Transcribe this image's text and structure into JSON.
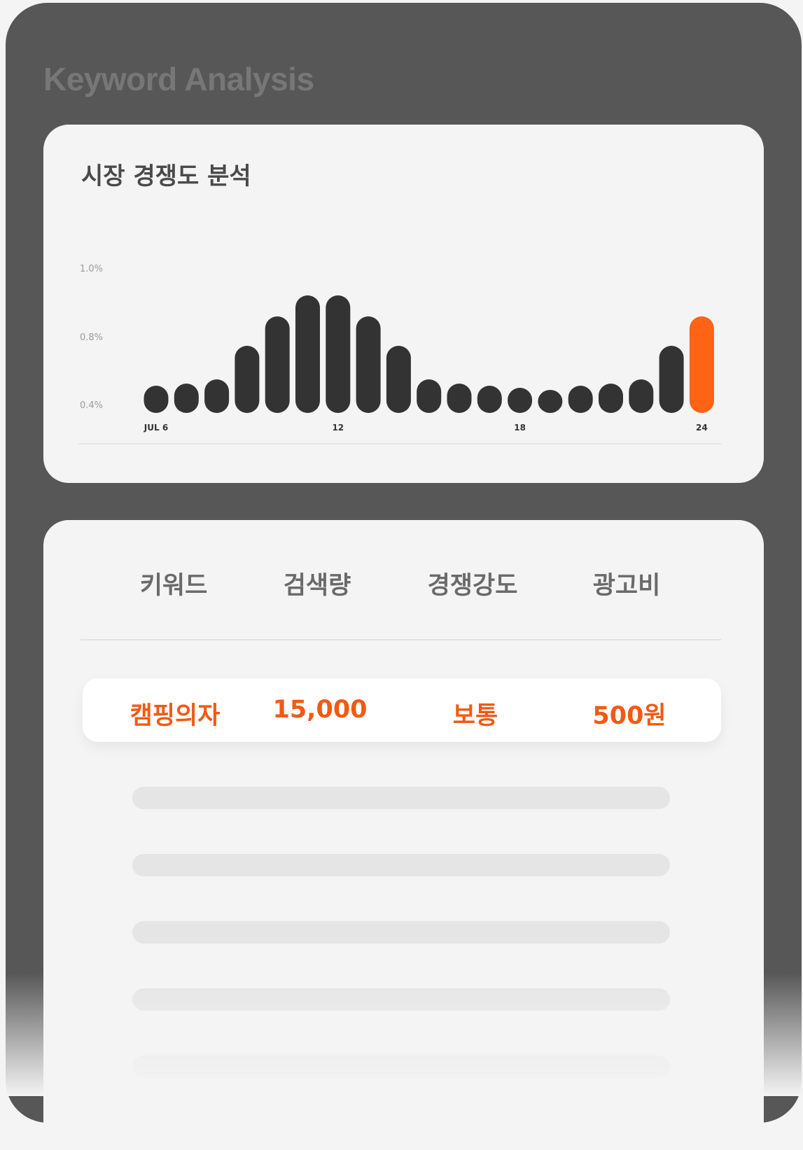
{
  "app": {
    "title": "Keyword Analysis"
  },
  "chart_card": {
    "title": "시장 경쟁도 분석"
  },
  "chart_data": {
    "type": "bar",
    "title": "시장 경쟁도 분석",
    "x": [
      6,
      7,
      8,
      9,
      10,
      11,
      12,
      13,
      14,
      15,
      16,
      17,
      18,
      19,
      20,
      21,
      22,
      23,
      24
    ],
    "x_tick_labels": [
      {
        "x": 6,
        "label": "JUL 6"
      },
      {
        "x": 12,
        "label": "12"
      },
      {
        "x": 18,
        "label": "18"
      },
      {
        "x": 24,
        "label": "24"
      }
    ],
    "y_tick_labels": [
      "1.0%",
      "0.8%",
      "0.4%"
    ],
    "values": [
      0.43,
      0.44,
      0.46,
      0.62,
      0.76,
      0.86,
      0.86,
      0.76,
      0.62,
      0.46,
      0.44,
      0.43,
      0.42,
      0.41,
      0.43,
      0.44,
      0.46,
      0.62,
      0.76
    ],
    "highlight_index": 18,
    "colors": {
      "bar": "#333333",
      "highlight": "#ff6314"
    },
    "ylim": [
      0.3,
      1.0
    ],
    "grid": false,
    "legend": "none"
  },
  "table": {
    "headers": [
      "키워드",
      "검색량",
      "경쟁강도",
      "광고비"
    ],
    "row": {
      "keyword": "캠핑의자",
      "search_volume": "15,000",
      "competition": "보통",
      "ad_cost": "500원"
    },
    "accent_color": "#f05a14"
  }
}
